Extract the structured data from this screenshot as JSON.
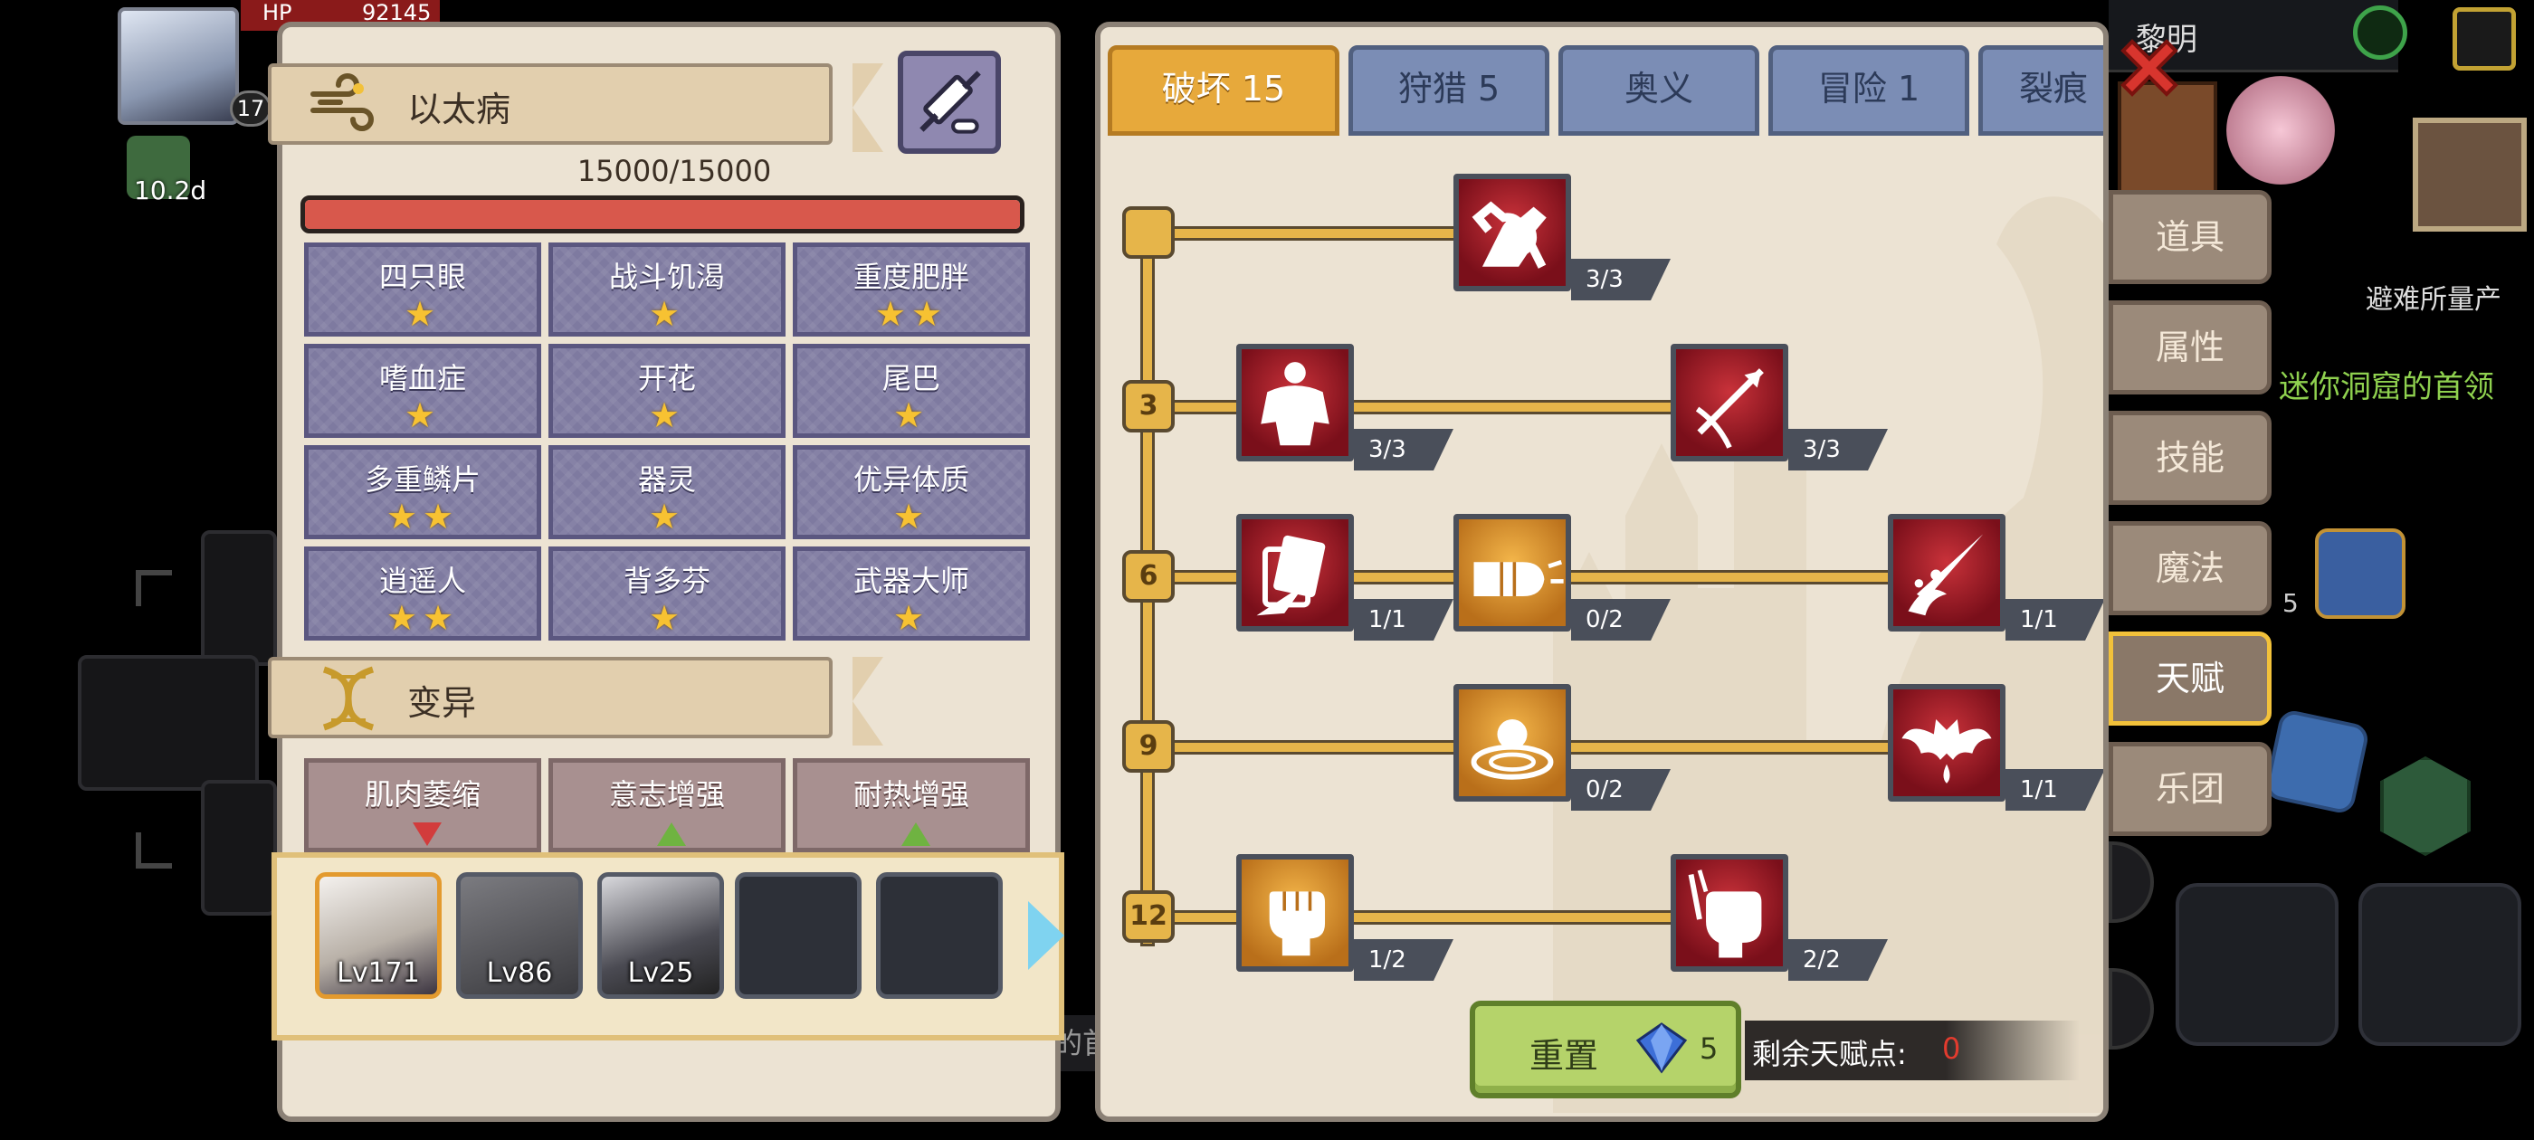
{
  "hud": {
    "hp_label": "HP",
    "hp_value": "92145",
    "player_level": "17",
    "buff_time": "10.2d",
    "right_top_text": "黎明",
    "shelter_text": "避难所量产",
    "quest_text": "迷你洞窟的首领",
    "bg_stack_count": "5",
    "bg_partial_text": "的首"
  },
  "left": {
    "disease_title": "以太病",
    "hp_text": "15000/15000",
    "hp_fraction": 1.0,
    "traits": [
      {
        "name": "四只眼",
        "stars": "★"
      },
      {
        "name": "战斗饥渴",
        "stars": "★"
      },
      {
        "name": "重度肥胖",
        "stars": "★★"
      },
      {
        "name": "嗜血症",
        "stars": "★"
      },
      {
        "name": "开花",
        "stars": "★"
      },
      {
        "name": "尾巴",
        "stars": "★"
      },
      {
        "name": "多重鳞片",
        "stars": "★★"
      },
      {
        "name": "器灵",
        "stars": "★"
      },
      {
        "name": "优异体质",
        "stars": "★"
      },
      {
        "name": "逍遥人",
        "stars": "★★"
      },
      {
        "name": "背多芬",
        "stars": "★"
      },
      {
        "name": "武器大师",
        "stars": "★"
      }
    ],
    "mutation_title": "变异",
    "mutations": [
      {
        "name": "肌肉萎缩",
        "dir": "down"
      },
      {
        "name": "意志增强",
        "dir": "up"
      },
      {
        "name": "耐热增强",
        "dir": "up"
      }
    ],
    "characters": [
      {
        "level": "Lv171"
      },
      {
        "level": "Lv86"
      },
      {
        "level": "Lv25"
      }
    ]
  },
  "tabs": [
    {
      "label": "破坏 15"
    },
    {
      "label": "狩猎 5"
    },
    {
      "label": "奥义"
    },
    {
      "label": "冒险 1"
    },
    {
      "label": "裂痕"
    }
  ],
  "tree": {
    "levels": [
      "3",
      "6",
      "9",
      "12"
    ],
    "skills": [
      {
        "name": "arm-wrestle",
        "count": "3/3"
      },
      {
        "name": "muscle-body",
        "count": "3/3"
      },
      {
        "name": "piercing-arrow",
        "count": "3/3"
      },
      {
        "name": "card-slash",
        "count": "1/1"
      },
      {
        "name": "fist-punch",
        "count": "0/2"
      },
      {
        "name": "blade-splash",
        "count": "1/1"
      },
      {
        "name": "shockwave",
        "count": "0/2"
      },
      {
        "name": "bat-blood",
        "count": "1/1"
      },
      {
        "name": "raised-fist",
        "count": "1/2"
      },
      {
        "name": "power-fist",
        "count": "2/2"
      }
    ],
    "reset_label": "重置",
    "reset_cost": "5",
    "remaining_label": "剩余天赋点:",
    "remaining_value": "0"
  },
  "side_menu": [
    {
      "label": "道具"
    },
    {
      "label": "属性"
    },
    {
      "label": "技能"
    },
    {
      "label": "魔法"
    },
    {
      "label": "天赋"
    },
    {
      "label": "乐团"
    }
  ],
  "colors": {
    "accent_gold": "#e6b54a",
    "tab_blue": "#7b8db5",
    "skill_red": "#b0242c",
    "skill_orange": "#e39a2e",
    "hp_red": "#d8584c",
    "points_red": "#e23b2e"
  }
}
